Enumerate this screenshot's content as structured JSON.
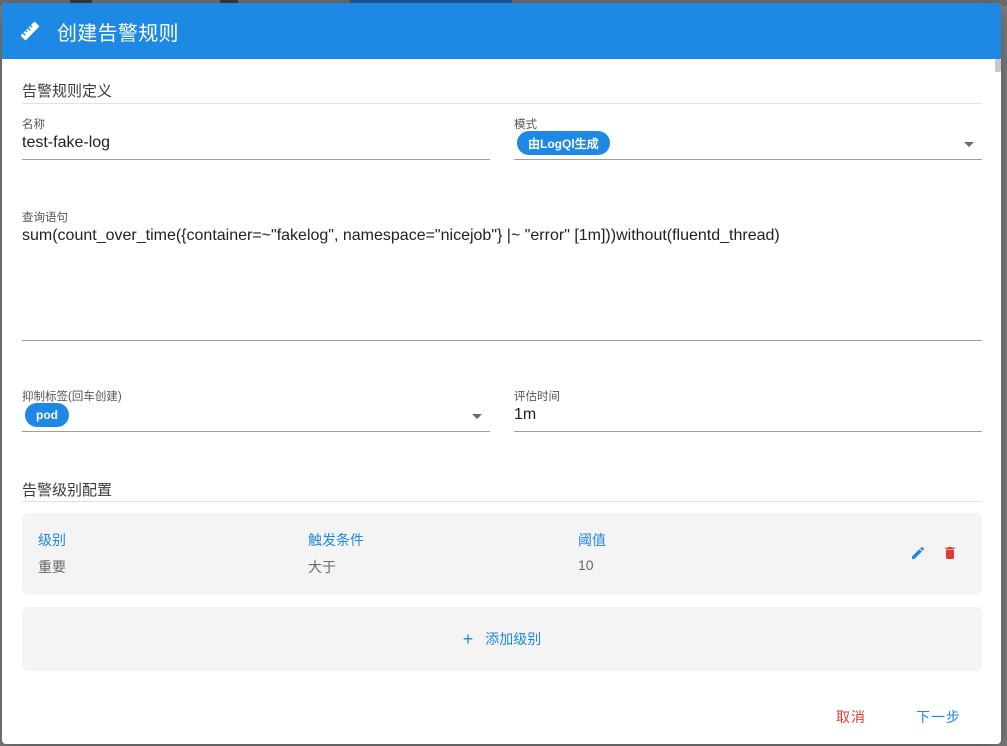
{
  "dialog": {
    "title": "创建告警规则"
  },
  "rule_definition": {
    "section_title": "告警规则定义",
    "name": {
      "label": "名称",
      "value": "test-fake-log"
    },
    "mode": {
      "label": "模式",
      "chip": "由LogQl生成"
    },
    "query": {
      "label": "查询语句",
      "value": "sum(count_over_time({container=~\"fakelog\", namespace=\"nicejob\"} |~ \"error\" [1m]))without(fluentd_thread)"
    },
    "inhibit_labels": {
      "label": "抑制标签(回车创建)",
      "chip": "pod"
    },
    "eval_time": {
      "label": "评估时间",
      "value": "1m"
    }
  },
  "level_config": {
    "section_title": "告警级别配置",
    "columns": {
      "level": "级别",
      "condition": "触发条件",
      "threshold": "阈值"
    },
    "rows": [
      {
        "level": "重要",
        "condition": "大于",
        "threshold": "10"
      }
    ],
    "add_label": "添加级别"
  },
  "footer": {
    "cancel_label": "取消",
    "next_label": "下一步"
  },
  "colors": {
    "primary": "#1e88e5",
    "danger": "#e53935",
    "card_bg": "#f4f4f4"
  },
  "icons": {
    "header": "ruler-icon",
    "edit": "pencil-icon",
    "delete": "trash-icon",
    "add": "plus-icon",
    "dropdown": "caret-down-icon"
  }
}
